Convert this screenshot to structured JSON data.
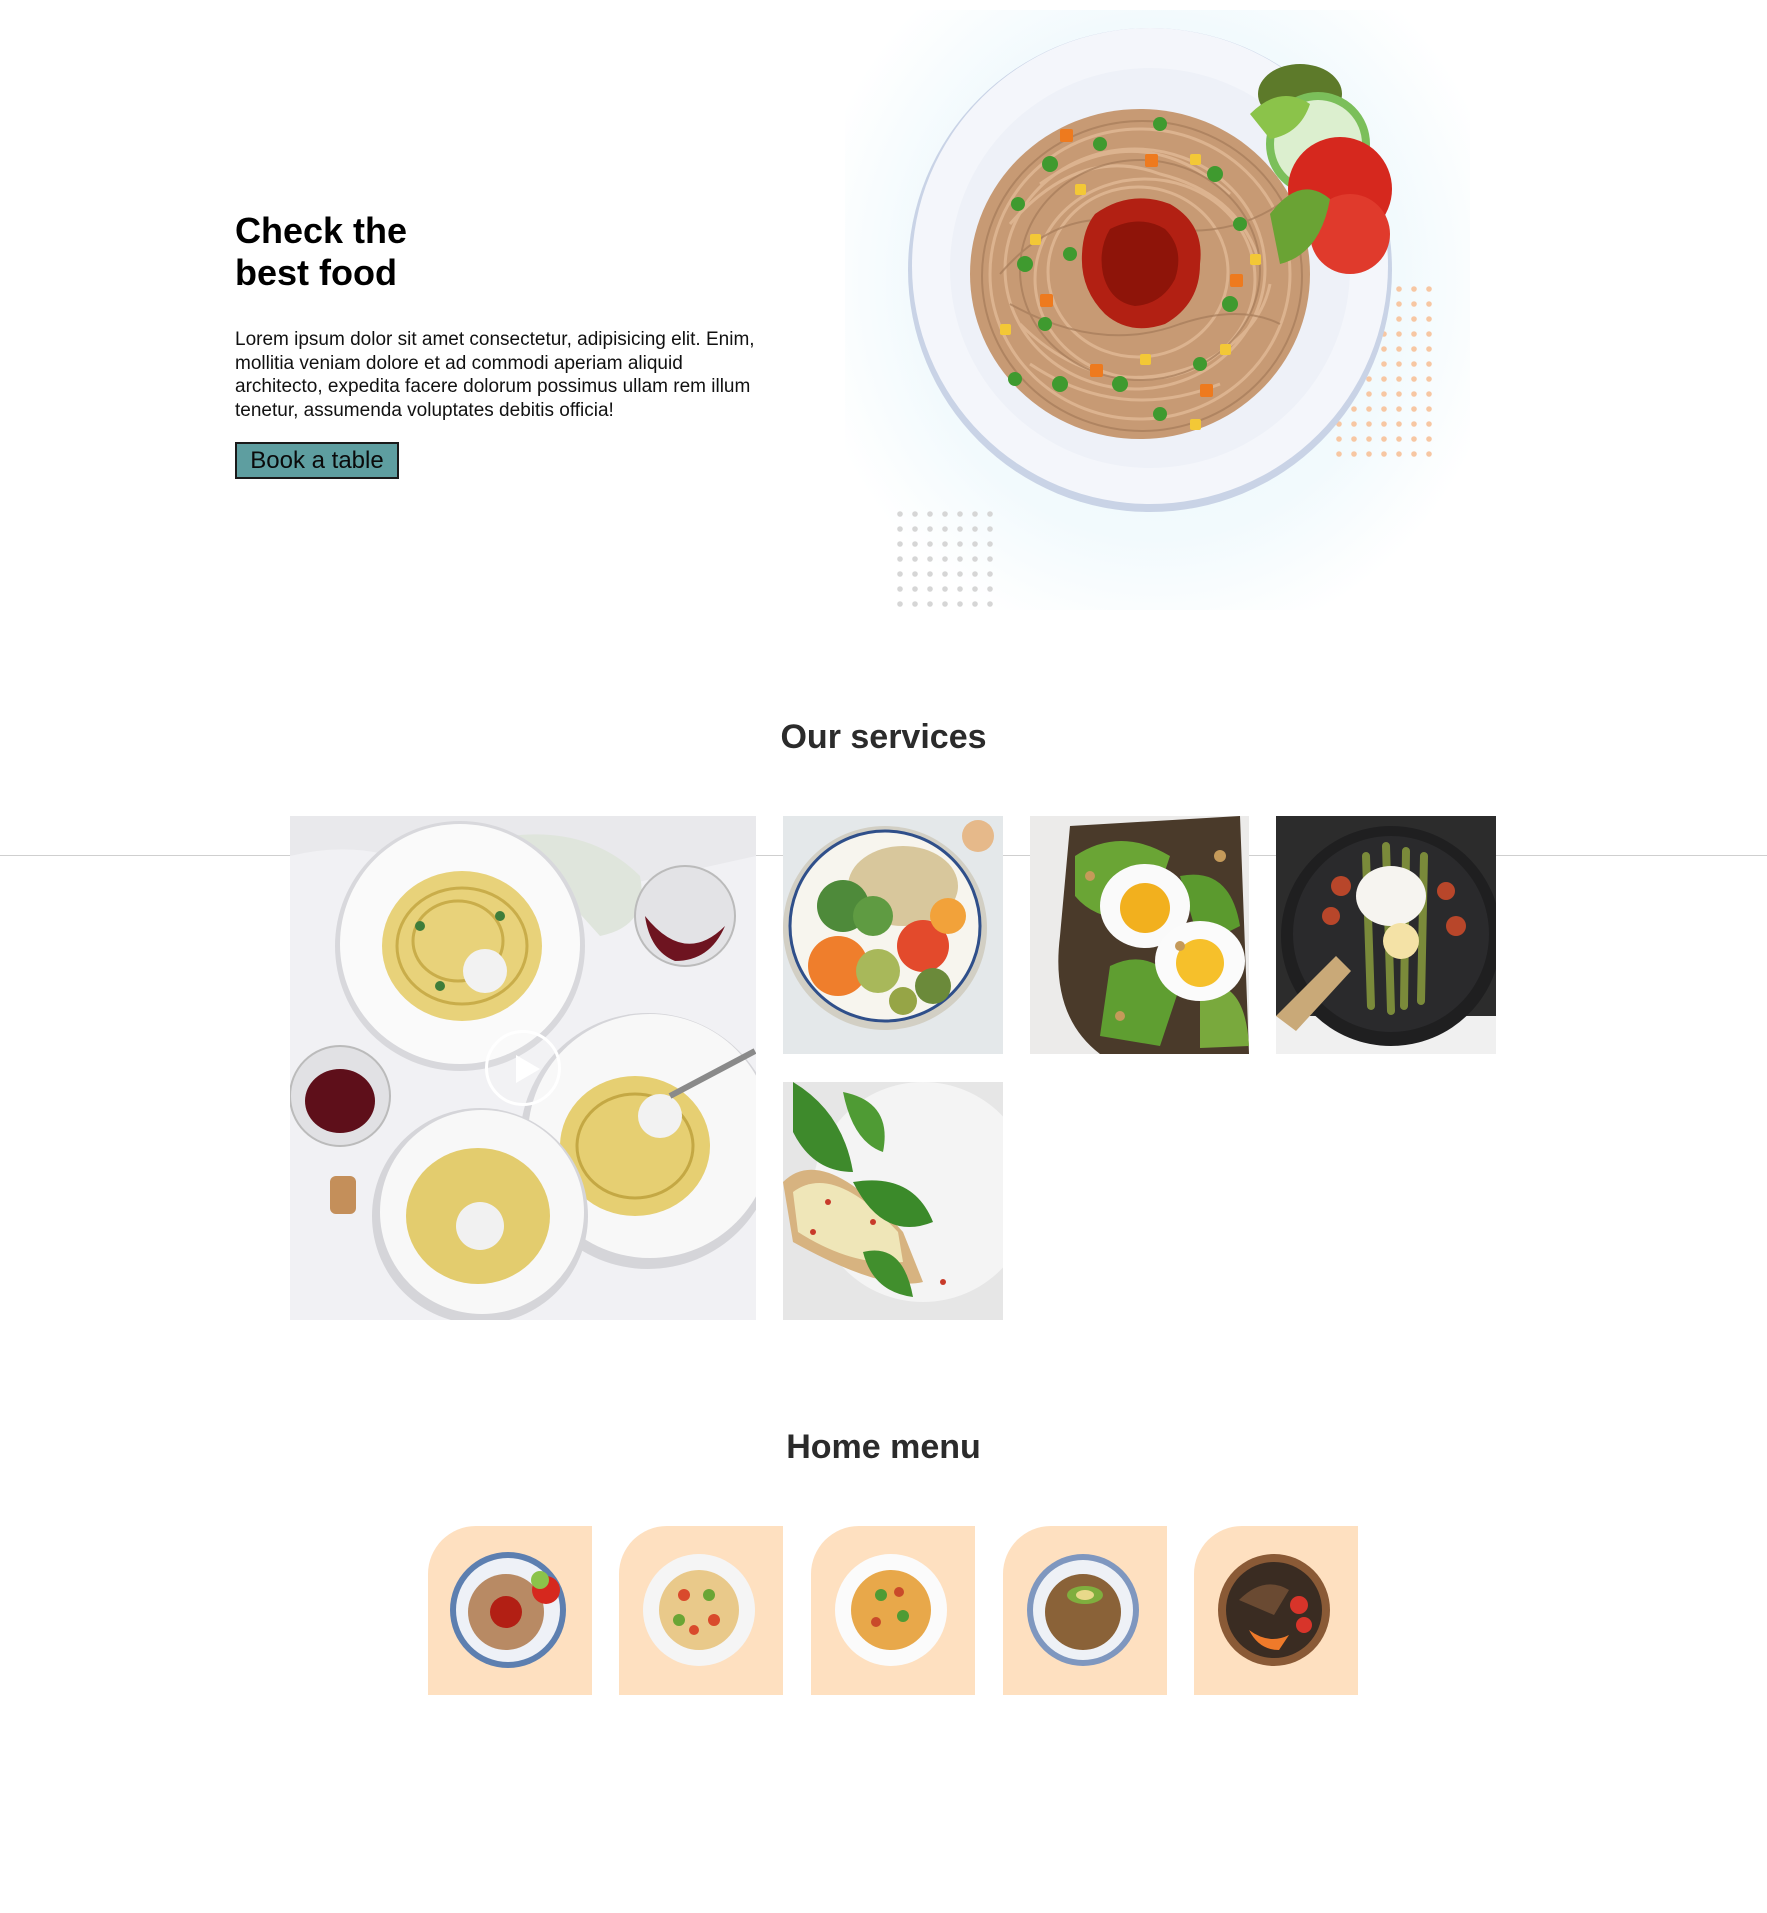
{
  "hero": {
    "title_line1": "Check the",
    "title_line2": "best food",
    "text": "Lorem ipsum dolor sit amet consectetur, adipisicing elit. Enim, mollitia veniam dolore et ad commodi aperiam aliquid architecto, expedita facere dolorum possimus ullam rem illum tenetur, assumenda voluptates debitis officia!",
    "cta_label": "Book a table",
    "image": "spaghetti-plate"
  },
  "services": {
    "title": "Our services",
    "tiles": [
      "pasta-table-video",
      "vegetable-bowl",
      "egg-avocado-toast",
      "asparagus-poached-egg",
      "spinach-toast"
    ],
    "play_icon": "play-icon"
  },
  "menu": {
    "title": "Home menu",
    "items": [
      "spaghetti-bowl",
      "penne-salad",
      "fusilli-bowl",
      "noodles-avocado",
      "meat-bowl"
    ]
  },
  "colors": {
    "cta_bg": "#5e9ea0",
    "menu_card_bg": "#fee0c0",
    "hero_glow": "#e9f7fb"
  }
}
